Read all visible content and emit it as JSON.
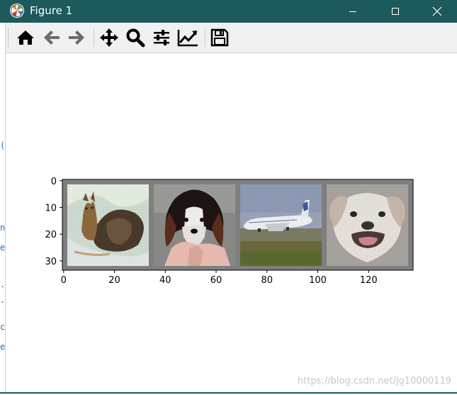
{
  "window": {
    "title": "Figure 1",
    "title_bar_color": "#1c5a5c"
  },
  "toolbar": {
    "buttons": [
      {
        "name": "home",
        "icon": "home-icon"
      },
      {
        "name": "back",
        "icon": "arrow-left-icon"
      },
      {
        "name": "forward",
        "icon": "arrow-right-icon"
      },
      {
        "name": "pan",
        "icon": "move-icon"
      },
      {
        "name": "zoom",
        "icon": "magnifier-icon"
      },
      {
        "name": "configure-subplots",
        "icon": "sliders-icon"
      },
      {
        "name": "edit-axis",
        "icon": "line-chart-icon"
      },
      {
        "name": "save",
        "icon": "floppy-disk-icon"
      }
    ]
  },
  "figure": {
    "x_ticks": [
      "0",
      "20",
      "40",
      "60",
      "80",
      "100",
      "120"
    ],
    "y_ticks": [
      "0",
      "10",
      "20",
      "30"
    ],
    "x_range": [
      -0.5,
      137.5
    ],
    "y_range": [
      33.5,
      -0.5
    ],
    "images": [
      {
        "subject": "cat",
        "x_range": [
          2,
          34
        ]
      },
      {
        "subject": "dog",
        "x_range": [
          36,
          68
        ]
      },
      {
        "subject": "plane",
        "x_range": [
          70,
          102
        ]
      },
      {
        "subject": "dog",
        "x_range": [
          104,
          136
        ]
      }
    ],
    "grid_border_color": "#7f7f7f"
  },
  "watermark": "https://blog.csdn.net/jg10000119"
}
